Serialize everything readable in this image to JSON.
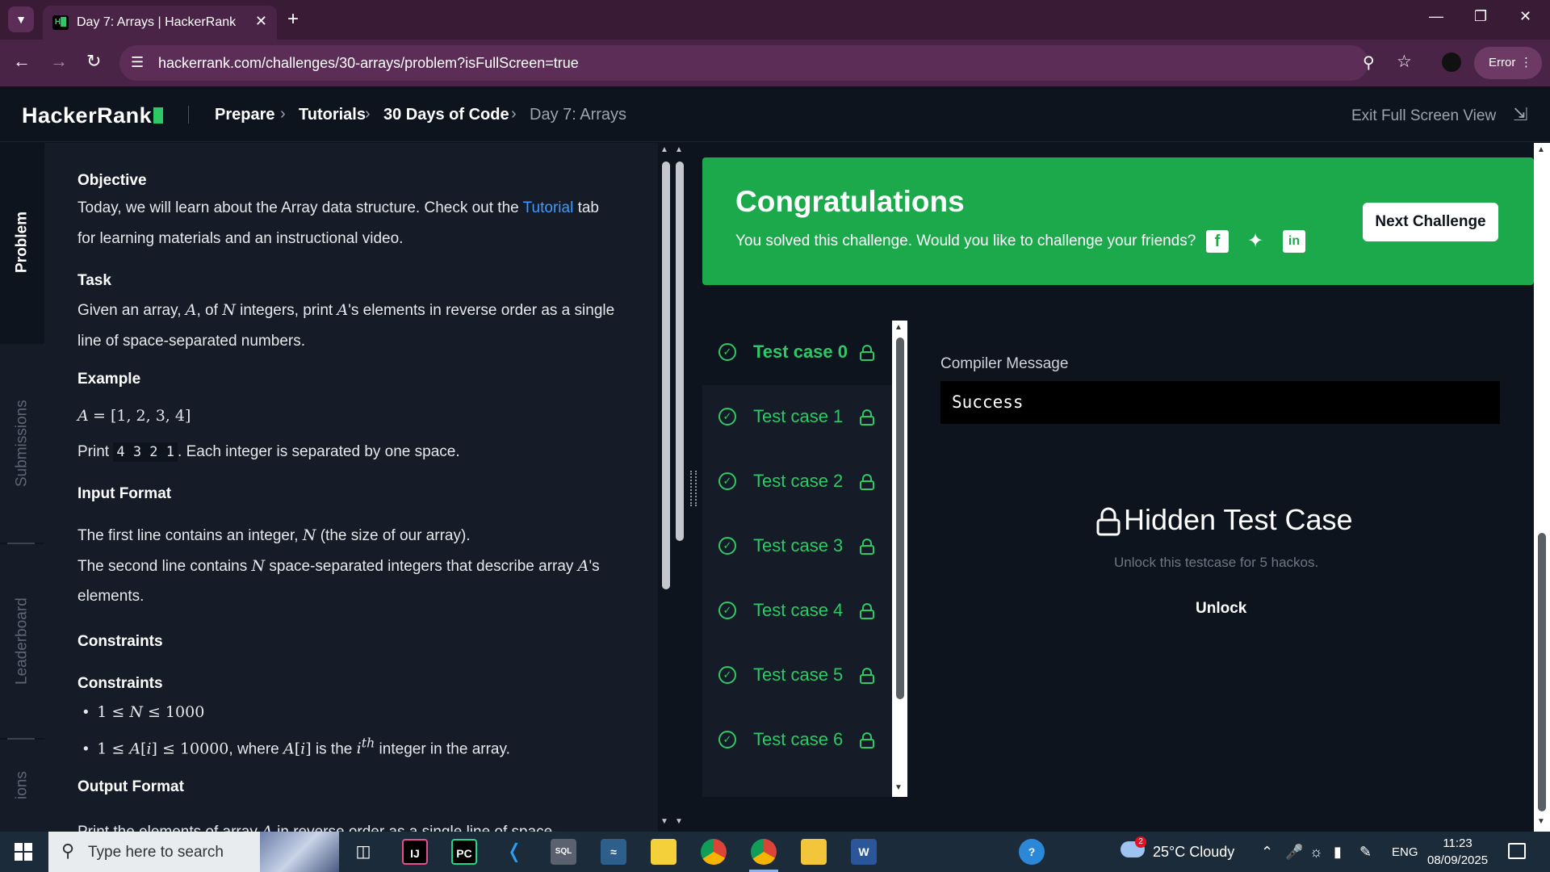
{
  "browser": {
    "tab_title": "Day 7: Arrays | HackerRank",
    "url": "hackerrank.com/challenges/30-arrays/problem?isFullScreen=true",
    "profile_label": "Error"
  },
  "header": {
    "logo": "HackerRank",
    "breadcrumb": [
      "Prepare",
      "Tutorials",
      "30 Days of Code",
      "Day 7: Arrays"
    ],
    "exit_fullscreen": "Exit Full Screen View"
  },
  "vtabs": {
    "problem": "Problem",
    "submissions": "Submissions",
    "leaderboard": "Leaderboard",
    "discussions": "ions"
  },
  "problem": {
    "objective_heading": "Objective",
    "objective_line1_pre": "Today, we will learn about the Array data structure. Check out the ",
    "objective_link": "Tutorial",
    "objective_line1_post": " tab",
    "objective_line2": "for learning materials and an instructional video.",
    "task_heading": "Task",
    "task_line2": "line of space-separated numbers.",
    "example_heading": "Example",
    "example_print_pre": "Print ",
    "example_print_code": "4 3 2 1",
    "example_print_post": ". Each integer is separated by one space.",
    "input_heading": "Input Format",
    "input_line3": "elements.",
    "constraints_heading1": "Constraints",
    "constraints_heading2": "Constraints",
    "output_heading": "Output Format"
  },
  "result": {
    "title": "Congratulations",
    "subtitle": "You solved this challenge. Would you like to challenge your friends?",
    "next_button": "Next Challenge",
    "test_cases": [
      "Test case 0",
      "Test case 1",
      "Test case 2",
      "Test case 3",
      "Test case 4",
      "Test case 5",
      "Test case 6"
    ],
    "compiler_label": "Compiler Message",
    "compiler_message": "Success",
    "hidden_title": "Hidden Test Case",
    "hidden_sub": "Unlock this testcase for 5 hackos.",
    "unlock_label": "Unlock"
  },
  "taskbar": {
    "search_placeholder": "Type here to search",
    "weather": "25°C  Cloudy",
    "weather_badge": "2",
    "lang": "ENG",
    "time": "11:23",
    "date": "08/09/2025"
  },
  "colors": {
    "accent_green": "#1ba94c",
    "bg_dark": "#0e141e",
    "panel": "#151c27"
  }
}
